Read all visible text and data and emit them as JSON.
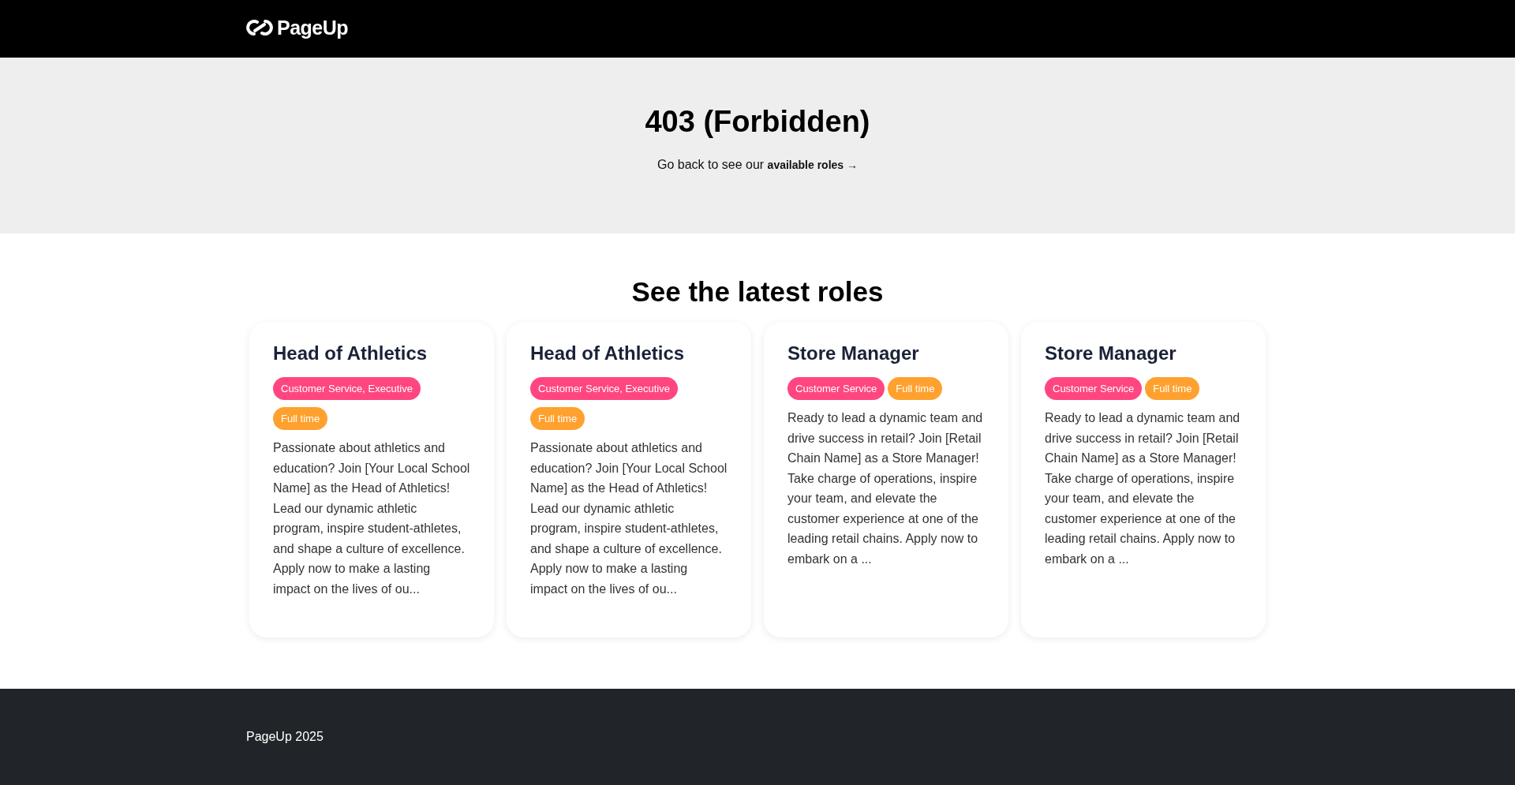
{
  "header": {
    "logo_text": "PageUp"
  },
  "hero": {
    "title": "403 (Forbidden)",
    "message": "Go back to see our",
    "link": "available roles →"
  },
  "roles_section": {
    "title": "See the latest roles",
    "cards": [
      {
        "title": "Head of Athletics",
        "tags": [
          {
            "label": "Customer Service, Executive",
            "color": "#ff4680"
          },
          {
            "label": "Full time",
            "color": "#ffa12f"
          }
        ],
        "description": "Passionate about athletics and education? Join [Your Local School Name] as the Head of Athletics! Lead our dynamic athletic program, inspire student-athletes, and shape a culture of excellence. Apply now to make a lasting impact on the lives of ou..."
      },
      {
        "title": "Head of Athletics",
        "tags": [
          {
            "label": "Customer Service, Executive",
            "color": "#ff4680"
          },
          {
            "label": "Full time",
            "color": "#ffa12f"
          }
        ],
        "description": "Passionate about athletics and education? Join [Your Local School Name] as the Head of Athletics! Lead our dynamic athletic program, inspire student-athletes, and shape a culture of excellence. Apply now to make a lasting impact on the lives of ou..."
      },
      {
        "title": "Store Manager",
        "tags": [
          {
            "label": "Customer Service",
            "color": "#ff4680"
          },
          {
            "label": "Full time",
            "color": "#ffa12f"
          }
        ],
        "description": "Ready to lead a dynamic team and drive success in retail? Join [Retail Chain Name] as a Store Manager! Take charge of operations, inspire your team, and elevate the customer experience at one of the leading retail chains. Apply now to embark on a ..."
      },
      {
        "title": "Store Manager",
        "tags": [
          {
            "label": "Customer Service",
            "color": "#ff4680"
          },
          {
            "label": "Full time",
            "color": "#ffa12f"
          }
        ],
        "description": "Ready to lead a dynamic team and drive success in retail? Join [Retail Chain Name] as a Store Manager! Take charge of operations, inspire your team, and elevate the customer experience at one of the leading retail chains. Apply now to embark on a ..."
      }
    ]
  },
  "footer": {
    "text": "PageUp 2025"
  }
}
